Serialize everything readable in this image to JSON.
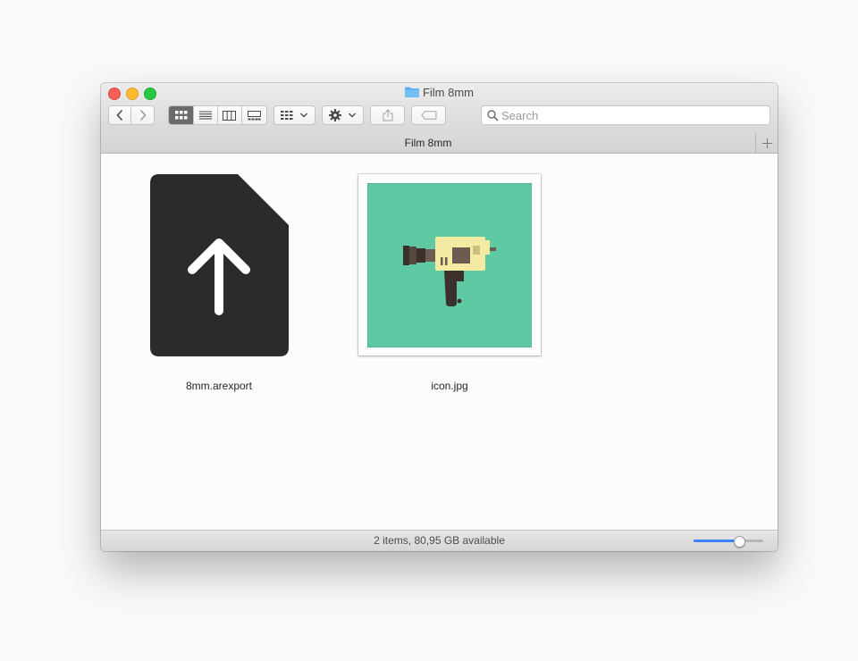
{
  "window": {
    "title": "Film 8mm",
    "title_icon": "folder-icon"
  },
  "toolbar": {
    "back_icon": "chevron-left-icon",
    "forward_icon": "chevron-right-icon",
    "view_modes": [
      "icon-view-icon",
      "list-view-icon",
      "column-view-icon",
      "gallery-view-icon"
    ],
    "active_view": "icon-view-icon",
    "arrange_icon": "arrange-grid-icon",
    "action_icon": "gear-icon",
    "share_icon": "share-icon",
    "tag_icon": "tag-icon"
  },
  "search": {
    "placeholder": "Search",
    "value": ""
  },
  "tabbar": {
    "tab_label": "Film 8mm",
    "add_icon": "plus-icon"
  },
  "files": [
    {
      "name": "8mm.arexport",
      "icon": "upload-document-icon"
    },
    {
      "name": "icon.jpg",
      "icon": "camera-thumbnail"
    }
  ],
  "status": {
    "text": "2 items, 80,95 GB available",
    "icon_size_level": 0.66
  },
  "colors": {
    "accent": "#3b82f7",
    "close": "#fc5f57",
    "minimize": "#fdbc2e",
    "zoom": "#28c840",
    "folder": "#6bb6ef",
    "document": "#2b2b2b",
    "thumbnail_bg": "#5fc9a4"
  }
}
